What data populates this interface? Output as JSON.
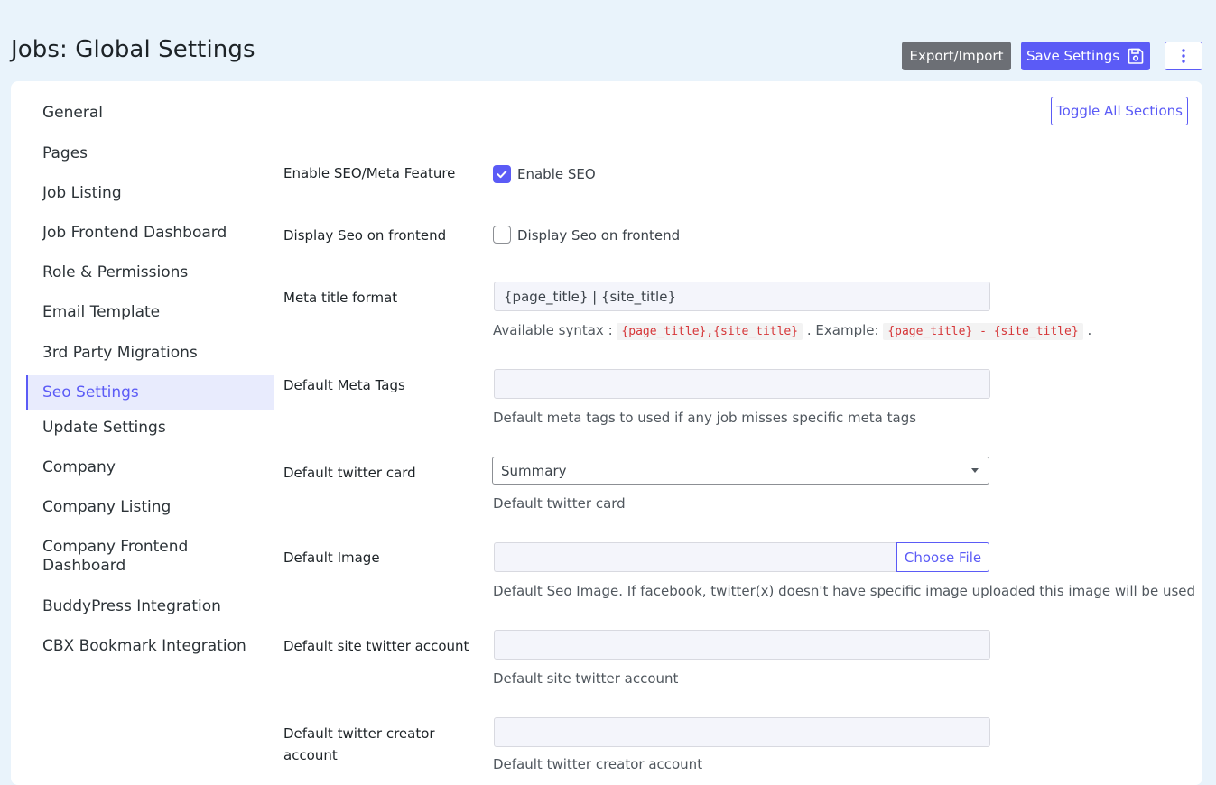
{
  "header": {
    "title": "Jobs: Global Settings",
    "export_label": "Export/Import",
    "save_label": "Save Settings"
  },
  "sidebar": {
    "items": [
      {
        "label": "General"
      },
      {
        "label": "Pages"
      },
      {
        "label": "Job Listing"
      },
      {
        "label": "Job Frontend Dashboard"
      },
      {
        "label": "Role & Permissions"
      },
      {
        "label": "Email Template"
      },
      {
        "label": "3rd Party Migrations"
      },
      {
        "label": "Seo Settings",
        "active": true
      },
      {
        "label": "Update Settings"
      },
      {
        "label": "Company"
      },
      {
        "label": "Company Listing"
      },
      {
        "label": "Company Frontend Dashboard"
      },
      {
        "label": "BuddyPress Integration"
      },
      {
        "label": "CBX Bookmark Integration"
      }
    ]
  },
  "main": {
    "toggle_label": "Toggle All Sections",
    "fields": {
      "enable_seo": {
        "label": "Enable SEO/Meta Feature",
        "option": "Enable SEO",
        "checked": true
      },
      "display_seo": {
        "label": "Display Seo on frontend",
        "option": "Display Seo on frontend",
        "checked": false
      },
      "meta_title": {
        "label": "Meta title format",
        "value": "{page_title} | {site_title}",
        "help_prefix": "Available syntax :",
        "help_code1": "{page_title},{site_title}",
        "help_mid": ". Example:",
        "help_code2": "{page_title} - {site_title}",
        "help_suffix": "."
      },
      "meta_tags": {
        "label": "Default Meta Tags",
        "value": "",
        "help": "Default meta tags to used if any job misses specific meta tags"
      },
      "twitter_card": {
        "label": "Default twitter card",
        "selected": "Summary",
        "help": "Default twitter card"
      },
      "default_image": {
        "label": "Default Image",
        "button": "Choose File",
        "help": "Default Seo Image. If facebook, twitter(x) doesn't have specific image uploaded this image will be used"
      },
      "site_twitter": {
        "label": "Default site twitter account",
        "value": "",
        "help": "Default site twitter account"
      },
      "creator_twitter": {
        "label": "Default twitter creator account",
        "value": "",
        "help": "Default twitter creator account"
      }
    }
  },
  "colors": {
    "accent": "#5b5bf6",
    "background": "#e9f3fb",
    "export_button": "#6c6f75",
    "code_text": "#d63638"
  },
  "icons": {
    "save": "floppy-disk-icon",
    "more": "vertical-dots-icon",
    "check": "checkmark-icon",
    "caret": "caret-down-icon"
  }
}
